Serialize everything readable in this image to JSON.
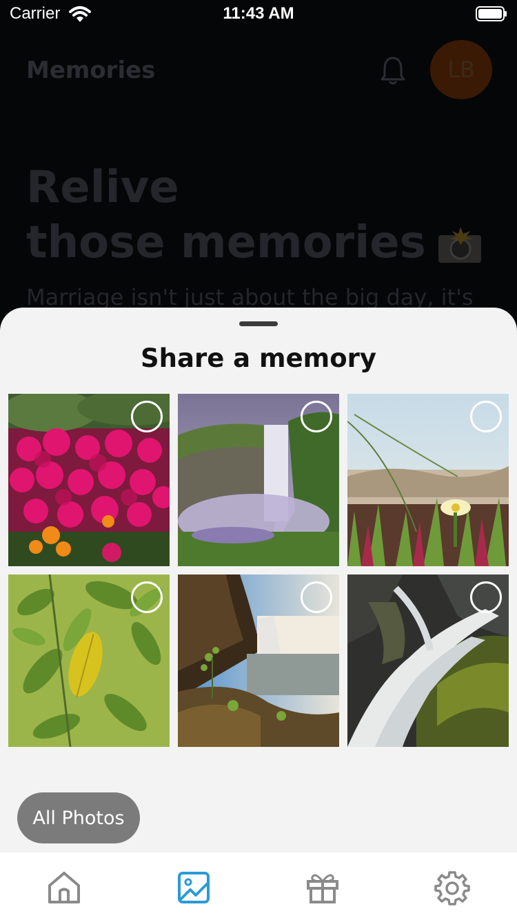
{
  "status_bar": {
    "carrier": "Carrier",
    "time": "11:43 AM"
  },
  "background": {
    "title": "Memories",
    "avatar_initials": "LB",
    "hero_line1": "Relive",
    "hero_line2": "those memories",
    "subtitle": "Marriage isn't just about the big day, it's"
  },
  "sheet": {
    "title": "Share a memory",
    "photos": [
      {
        "subject": "pink and orange flowers",
        "selected": false
      },
      {
        "subject": "waterfall with purple mist",
        "selected": false
      },
      {
        "subject": "yellow flower and grass",
        "selected": false
      },
      {
        "subject": "green leaves with yellow leaf",
        "selected": false
      },
      {
        "subject": "waterfall in canyon at sunset",
        "selected": false
      },
      {
        "subject": "cascading waterfall over mossy rocks",
        "selected": false
      }
    ],
    "all_photos_label": "All Photos"
  },
  "tabs": [
    {
      "icon": "home-icon",
      "active": false
    },
    {
      "icon": "image-icon",
      "active": true
    },
    {
      "icon": "gift-icon",
      "active": false
    },
    {
      "icon": "gear-icon",
      "active": false
    }
  ],
  "colors": {
    "accent": "#2a9ad6",
    "inactive": "#8a8a8a",
    "sheet_bg": "#f3f3f3"
  }
}
